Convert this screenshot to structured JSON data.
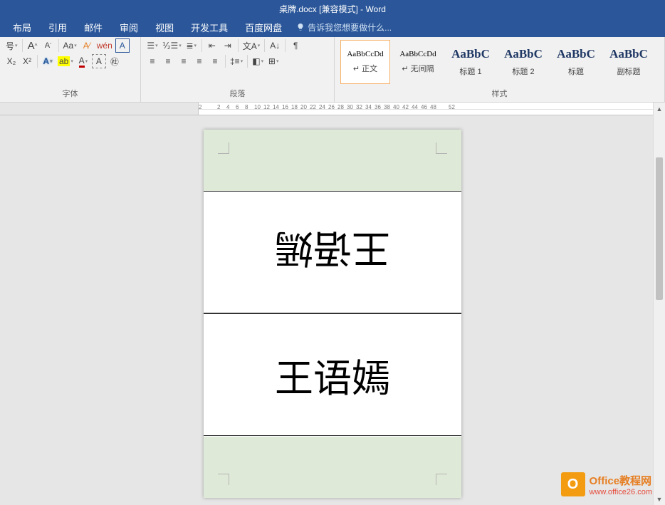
{
  "title": "桌牌.docx [兼容模式] - Word",
  "tabs": [
    "布局",
    "引用",
    "邮件",
    "审阅",
    "视图",
    "开发工具",
    "百度网盘"
  ],
  "tell_me": "告诉我您想要做什么...",
  "groups": {
    "font": "字体",
    "paragraph": "段落",
    "styles": "样式"
  },
  "font_row1": {
    "fontsize_label": "号",
    "grow": "A",
    "shrink": "A",
    "case": "Aa",
    "phonetic": "wén",
    "border": "A"
  },
  "font_row2": {
    "sub": "X₂",
    "sup": "X²",
    "effects": "A",
    "highlight": "aᵇʸ",
    "color": "A",
    "charborder": "A",
    "circled": "字"
  },
  "styles": [
    {
      "preview": "AaBbCcDd",
      "name": "↵ 正文",
      "big": false,
      "selected": true
    },
    {
      "preview": "AaBbCcDd",
      "name": "↵ 无间隔",
      "big": false,
      "selected": false
    },
    {
      "preview": "AaBbC",
      "name": "标题 1",
      "big": true,
      "selected": false
    },
    {
      "preview": "AaBbC",
      "name": "标题 2",
      "big": true,
      "selected": false
    },
    {
      "preview": "AaBbC",
      "name": "标题",
      "big": true,
      "selected": false
    },
    {
      "preview": "AaBbC",
      "name": "副标题",
      "big": true,
      "selected": false
    }
  ],
  "ruler_ticks": [
    "2",
    "",
    "2",
    "4",
    "6",
    "8",
    "10",
    "12",
    "14",
    "16",
    "18",
    "20",
    "22",
    "24",
    "26",
    "28",
    "30",
    "32",
    "34",
    "36",
    "38",
    "40",
    "42",
    "44",
    "46",
    "48",
    "",
    "52"
  ],
  "document": {
    "name1": "王语嫣",
    "name2": "王语嫣"
  },
  "watermark": {
    "brand": "Office教程网",
    "url": "www.office26.com",
    "badge": "O"
  }
}
